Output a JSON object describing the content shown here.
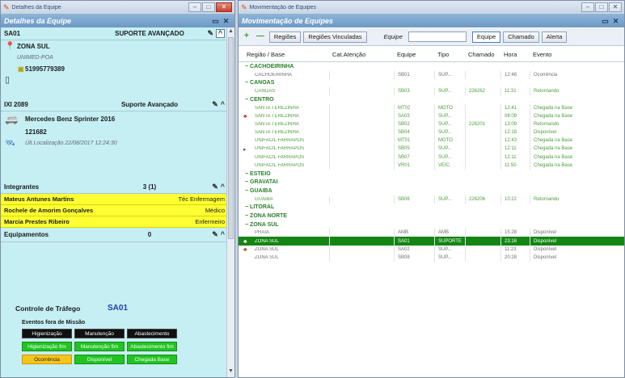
{
  "left": {
    "window_title": "Detalhes da Equipe",
    "header_title": "Detalhes da Equipe",
    "unit": {
      "code": "SA01",
      "type": "SUPORTE AVANÇADO",
      "zone": "ZONA SUL",
      "subtitle": "UNIMED-POA",
      "phone": "51995779389"
    },
    "vehicle": {
      "code": "IXI 2089",
      "type": "Suporte Avançado",
      "model": "Mercedes Benz Sprinter 2016",
      "id": "121682",
      "last_location": "Ült.Localização 22/08/2017 12:24:30"
    },
    "members": {
      "label": "Integrantes",
      "count": "3 (1)",
      "list": [
        {
          "name": "Mateus Antunes Martins",
          "role": "Téc Enfermagem"
        },
        {
          "name": "Rochele de Amorim Gonçalves",
          "role": "Médico"
        },
        {
          "name": "Marcia Prestes Ribeiro",
          "role": "Enfermeiro"
        }
      ]
    },
    "equipment": {
      "label": "Equipamentos",
      "count": "0"
    },
    "traffic": {
      "title": "Controle de Tráfego",
      "code": "SA01",
      "subtitle": "Eventos fora de Missão",
      "row1": [
        "Higienização",
        "Manutenção",
        "Abastecimento"
      ],
      "row2": [
        "Higienização fim",
        "Manutenção fim",
        "Abastecimento fim"
      ],
      "row3": [
        "Ocorrência",
        "Disponível",
        "Chegada Base"
      ]
    }
  },
  "right": {
    "window_title": "Movimentação de Equipes",
    "header_title": "Movimentação de Equipes",
    "toolbar": {
      "add_label": "+",
      "remove_label": "—",
      "regioes": "Regiões",
      "regioes_vinc": "Regiões Vinculadas",
      "equipe_label": "Equipe",
      "equipe_value": "",
      "btn_equipe": "Equipe",
      "btn_chamado": "Chamado",
      "btn_alerta": "Alerta"
    },
    "columns": [
      "Região / Base",
      "Cat.Atenção",
      "Equipe",
      "Tipo",
      "Chamado",
      "Hora",
      "Evento"
    ],
    "rows": [
      {
        "kind": "grp",
        "c1": "CACHOEIRINHA"
      },
      {
        "kind": "row",
        "c1": "CACHOEIRINHA",
        "c3": "SB01",
        "c4": "SUP...",
        "c5": "",
        "c6": "12:48",
        "c7": "Ocorrência"
      },
      {
        "kind": "grp",
        "c1": "CANOAS"
      },
      {
        "kind": "green",
        "c1": "CANOAS",
        "c3": "SB03",
        "c4": "SUP...",
        "c5": "226262",
        "c6": "11:31",
        "c7": "Retornando"
      },
      {
        "kind": "grp",
        "c1": "CENTRO"
      },
      {
        "kind": "green",
        "c1": "SANTA TEREZINHA",
        "c3": "MT02",
        "c4": "MOTO",
        "c5": "",
        "c6": "12:41",
        "c7": "Chegada na Base"
      },
      {
        "kind": "green",
        "c1": "SANTA TEREZINHA",
        "c3": "SA03",
        "c4": "SUP...",
        "c5": "",
        "c6": "08:09",
        "c7": "Chegada na Base",
        "icon": true
      },
      {
        "kind": "green",
        "c1": "SANTA TEREZINHA",
        "c3": "SB02",
        "c4": "SUP...",
        "c5": "226201",
        "c6": "13:09",
        "c7": "Retornando"
      },
      {
        "kind": "green",
        "c1": "SANTA TEREZINHA",
        "c3": "SB04",
        "c4": "SUP...",
        "c5": "",
        "c6": "12:18",
        "c7": "Disponível"
      },
      {
        "kind": "green",
        "c1": "UNIFACIL FARRAPOS",
        "c3": "MT01",
        "c4": "MOTO",
        "c5": "",
        "c6": "12:43",
        "c7": "Chegada na Base"
      },
      {
        "kind": "green",
        "c1": "UNIFACIL FARRAPOS",
        "c3": "SB05",
        "c4": "SUP...",
        "c5": "",
        "c6": "12:11",
        "c7": "Chegada na Base",
        "arrow": true
      },
      {
        "kind": "green",
        "c1": "UNIFACIL FARRAPOS",
        "c3": "SB07",
        "c4": "SUP...",
        "c5": "",
        "c6": "12:11",
        "c7": "Chegada na Base"
      },
      {
        "kind": "green",
        "c1": "UNIFACIL FARRAPOS",
        "c3": "VR01",
        "c4": "VEIC.",
        "c5": "",
        "c6": "11:50",
        "c7": "Chegada na Base"
      },
      {
        "kind": "grp",
        "c1": "ESTEIO"
      },
      {
        "kind": "grp",
        "c1": "GRAVATAÍ"
      },
      {
        "kind": "grp",
        "c1": "GUAÍBA"
      },
      {
        "kind": "green",
        "c1": "GUAÍBA",
        "c3": "SB06",
        "c4": "SUP...",
        "c5": "226206",
        "c6": "10:22",
        "c7": "Retornando"
      },
      {
        "kind": "grp",
        "c1": "LITORAL"
      },
      {
        "kind": "grp",
        "c1": "ZONA NORTE"
      },
      {
        "kind": "grp",
        "c1": "ZONA SUL"
      },
      {
        "kind": "row",
        "c1": "PRAIA",
        "c3": "AMB",
        "c4": "AMB",
        "c5": "",
        "c6": "15:28",
        "c7": "Disponível"
      },
      {
        "kind": "sel",
        "c1": "ZONA SUL",
        "c3": "SA01",
        "c4": "SUPORTE",
        "c5": "",
        "c6": "23:16",
        "c7": "Disponível",
        "icon": true
      },
      {
        "kind": "row",
        "c1": "ZONA SUL",
        "c3": "SA02",
        "c4": "SUP...",
        "c5": "",
        "c6": "11:23",
        "c7": "Disponível",
        "icon": true
      },
      {
        "kind": "row",
        "c1": "ZONA SUL",
        "c3": "SB08",
        "c4": "SUP...",
        "c5": "",
        "c6": "20:28",
        "c7": "Disponível"
      }
    ]
  },
  "colors": {
    "accent": "#148514",
    "header": "#7aa5cf",
    "member_bg": "#ffff33",
    "panel_bg": "#c6eff4"
  }
}
